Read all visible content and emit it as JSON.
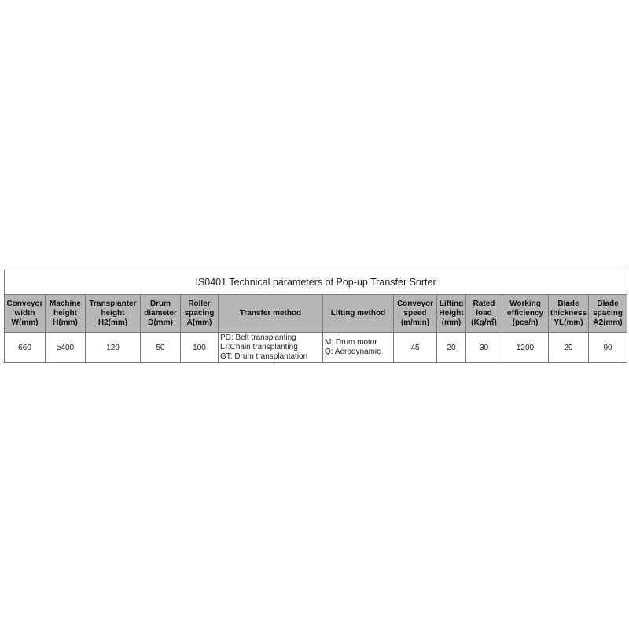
{
  "title": "IS0401 Technical parameters of Pop-up Transfer Sorter",
  "headers": [
    [
      "Conveyor",
      "width",
      "W(mm)"
    ],
    [
      "Machine",
      "height",
      "H(mm)"
    ],
    [
      "Transplanter",
      "height",
      "H2(mm)"
    ],
    [
      "Drum",
      "diameter",
      "D(mm)"
    ],
    [
      "Roller",
      "spacing",
      "A(mm)"
    ],
    [
      "Transfer method"
    ],
    [
      "Lifting method"
    ],
    [
      "Conveyor",
      "speed",
      "(m/min)"
    ],
    [
      "Lifting",
      "Height",
      "(mm)"
    ],
    [
      "Rated",
      "load",
      "(Kg/㎡)"
    ],
    [
      "Working",
      "efficiency",
      "(pcs/h)"
    ],
    [
      "Blade",
      "thickness",
      "YL(mm)"
    ],
    [
      "Blade",
      "spacing",
      "A2(mm)"
    ]
  ],
  "values": {
    "conveyor_width": "660",
    "machine_height": "≥400",
    "transplanter_height": "120",
    "drum_diameter": "50",
    "roller_spacing": "100",
    "transfer_method": [
      "PD:  Belt transplanting",
      "LT:Chain transplanting",
      "GT:  Drum transplantation"
    ],
    "lifting_method": [
      "M:  Drum motor",
      "Q:  Aerodynamic"
    ],
    "conveyor_speed": "45",
    "lifting_height": "20",
    "rated_load": "30",
    "working_efficiency": "1200",
    "blade_thickness": "29",
    "blade_spacing": "90"
  }
}
